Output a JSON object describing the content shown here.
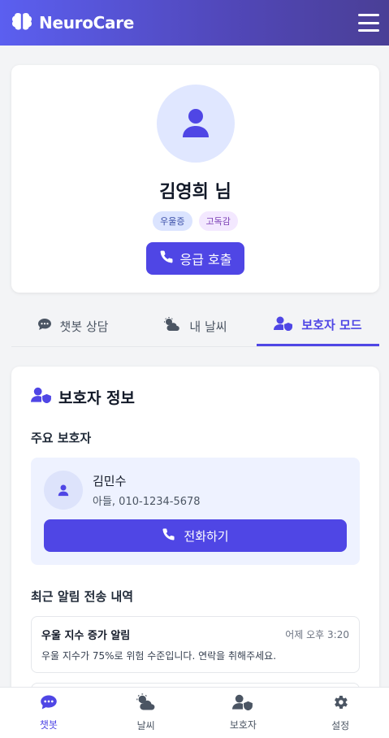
{
  "header": {
    "title": "NeuroCare",
    "logo_icon": "brain-icon",
    "menu_icon": "hamburger-menu-icon"
  },
  "profile": {
    "name": "김영희 님",
    "tags": [
      "우울증",
      "고독감"
    ],
    "emergency_label": "응급 호출"
  },
  "tabs": [
    {
      "label": "챗봇 상담",
      "icon": "chat-icon",
      "active": false
    },
    {
      "label": "내 날씨",
      "icon": "weather-icon",
      "active": false
    },
    {
      "label": "보호자 모드",
      "icon": "guardian-icon",
      "active": true
    }
  ],
  "guardian": {
    "title": "보호자 정보",
    "primary_label": "주요 보호자",
    "primary": {
      "name": "김민수",
      "detail": "아들, 010-1234-5678"
    },
    "call_label": "전화하기",
    "history_label": "최근 알림 전송 내역",
    "alerts": [
      {
        "title": "우울 지수 증가 알림",
        "time": "어제 오후 3:20",
        "message": "우울 지수가 75%로 위험 수준입니다. 연락을 취해주세요."
      }
    ]
  },
  "bottom_nav": [
    {
      "label": "챗봇",
      "icon": "chat-icon",
      "active": true
    },
    {
      "label": "날씨",
      "icon": "weather-icon",
      "active": false
    },
    {
      "label": "보호자",
      "icon": "guardian-icon",
      "active": false
    },
    {
      "label": "설정",
      "icon": "gear-icon",
      "active": false
    }
  ],
  "colors": {
    "accent": "#4f46e5",
    "header_start": "#5b5ff0",
    "header_end": "#4a3f96"
  }
}
